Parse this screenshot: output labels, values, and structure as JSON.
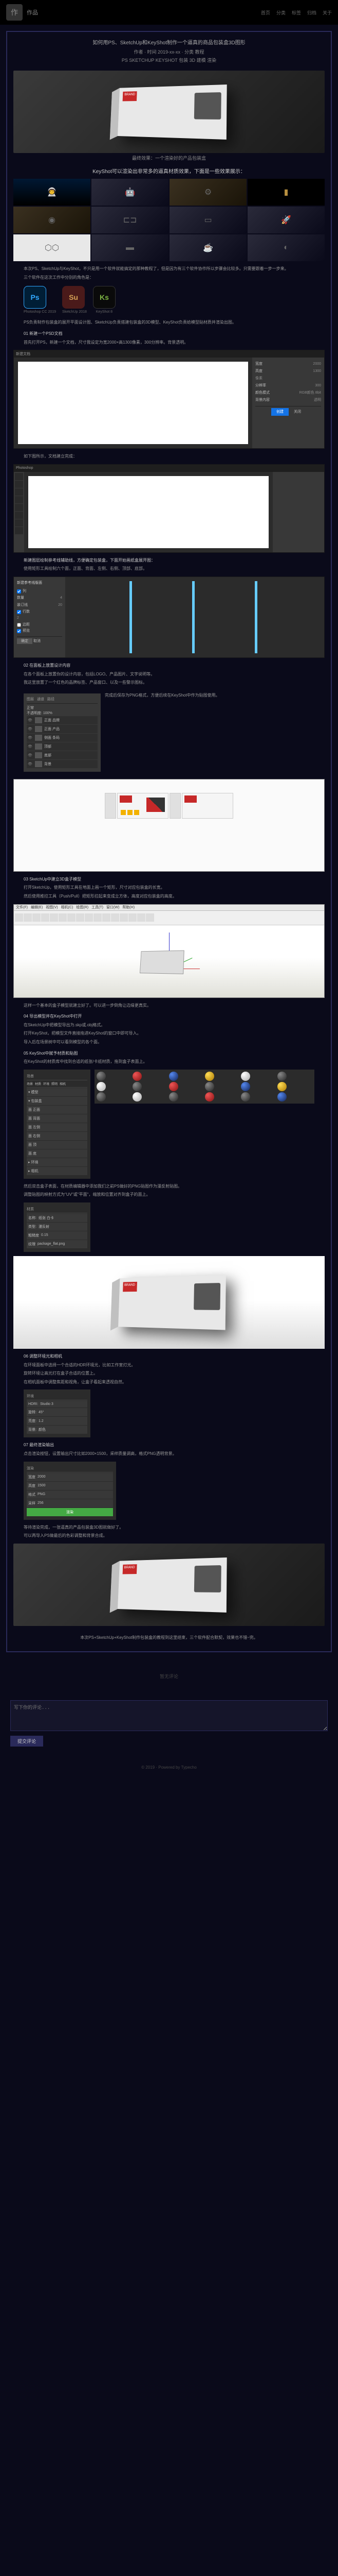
{
  "header": {
    "brand": "作品",
    "nav": [
      "首页",
      "分类",
      "标签",
      "归档",
      "关于"
    ]
  },
  "title": {
    "t1": "如何用PS、SketchUp和KeyShot制作一个逼真的商品包装盒3D图形",
    "t2": "作者 · 时间 2019-xx-xx · 分类 教程",
    "t3": "PS SKETCHUP KEYSHOT 包装 3D 建模 渲染"
  },
  "hero_cap": "最终效果：一个渲染好的产品包装盒",
  "grid_cap": "KeyShot可以渲染出非常多的逼真材质效果，下面是一些效果展示：",
  "body": {
    "p1": "本次PS、SketchUp与KeyShot，不只是用一个软件就能搞定的那种教程了，但是因为有三个软件协作所以步骤会比较多。只需要跟着一步一步来。",
    "p2": "三个软件在这次工作中分别的角色是：",
    "apps": [
      {
        "id": "Ps",
        "lbl": "Photoshop CC 2019"
      },
      {
        "id": "Su",
        "lbl": "SketchUp 2018"
      },
      {
        "id": "Ks",
        "lbl": "KeyShot 8"
      }
    ],
    "p3": "PS负责制作包装盒的展开平面设计图、SketchUp负责搭建包装盒的3D模型、KeyShot负责给模型贴材质并渲染出图。"
  },
  "step1": {
    "h": "01 新建一个PSD文档",
    "p1": "首先打开PS，新建一个文档，尺寸我设定为宽2000×高1300像素，300分辨率。背景透明。",
    "p2": "如下图所示，文档建立完成：",
    "dlg": {
      "title": "新建文档",
      "w": "宽度",
      "wv": "2000",
      "h": "高度",
      "hv": "1300",
      "unit": "像素",
      "res": "分辨率",
      "resv": "300",
      "mode": "颜色模式",
      "modev": "RGB颜色 8bit",
      "bg": "背景内容",
      "bgv": "透明",
      "ok": "创建",
      "cancel": "关闭"
    }
  },
  "step2": {
    "h": "新建图层绘制参考线辅助线，方便确定包装盒，下面开始画纸盒展开图：",
    "p1": "使用矩形工具绘制六个面，正面、背面、左侧、右侧、顶部、底部。",
    "guide": {
      "title": "新建参考线版面",
      "col": "列",
      "colv": "4",
      "gut": "装订线",
      "gutv": "20",
      "row": "行数",
      "rowv": "2",
      "mar": "边距",
      "ok": "确定",
      "cancel": "取消",
      "preview": "预览"
    }
  },
  "step3": {
    "h": "02 在面板上放置设计内容",
    "p1": "在各个面板上放置你的设计内容，包括LOGO、产品图片、文字说明等。",
    "p2": "我这里放置了一个红色的品牌标签、产品窗口、以及一些警示图标。",
    "p3": "完成后保存为PNG格式，方便后续在KeyShot中作为贴图使用。",
    "layers": {
      "tabs": [
        "图层",
        "通道",
        "路径"
      ],
      "mode": "正常",
      "opacity": "不透明度: 100%",
      "items": [
        "正面 品牌",
        "正面 产品",
        "侧面 条码",
        "顶部",
        "底部",
        "背景"
      ]
    }
  },
  "step4": {
    "h": "03 SketchUp中建立3D盒子模型",
    "p1": "打开SketchUp，使用矩形工具在地面上画一个矩形，尺寸对应包装盒的长宽。",
    "p2": "然后使用推拉工具（Push/Pull）把矩形拉起来变成立方体，高度对应包装盒的高度。",
    "p3": "这样一个基本的盒子模型就建立好了。可以进一步倒角让边缘更真实。",
    "menu": [
      "文件(F)",
      "编辑(E)",
      "视图(V)",
      "相机(C)",
      "绘图(R)",
      "工具(T)",
      "窗口(W)",
      "帮助(H)"
    ]
  },
  "step5": {
    "h": "04 导出模型并在KeyShot中打开",
    "p1": "在SketchUp中把模型导出为.skp或.obj格式。",
    "p2": "打开KeyShot，把模型文件直接拖进KeyShot的窗口中即可导入。",
    "p3": "导入后在场景树中可以看到模型的各个面。"
  },
  "step6": {
    "h": "05 KeyShot中赋予材质和贴图",
    "p1": "在KeyShot的材质库中找到合适的纸张/卡纸材质，拖到盒子表面上。",
    "p2": "然后双击盒子表面，在材质编辑器中添加我们之前PS做好的PNG贴图作为漫反射贴图。",
    "p3": "调整贴图的映射方式为\"UV\"或\"平面\"，缩放和位置对齐到盒子的面上。",
    "scene": {
      "title": "场景",
      "tabs": [
        "场景",
        "材质",
        "环境",
        "照明",
        "相机",
        "图像"
      ],
      "items": [
        "▾ 模型",
        "  ▾ 包装盒",
        "    面 正面",
        "    面 背面",
        "    面 左侧",
        "    面 右侧",
        "    面 顶",
        "    面 底",
        "▸ 环境",
        "▸ 相机"
      ]
    },
    "mat": {
      "title": "材质",
      "name": "名称:",
      "namev": "纸张 白卡",
      "type": "类型:",
      "typev": "漫反射",
      "rough": "粗糙度",
      "roughv": "0.15",
      "tex": "纹理",
      "texv": "package_flat.png"
    }
  },
  "step7": {
    "h": "06 调整环境光和相机",
    "p1": "在环境面板中选择一个合适的HDR环境光，比如工作室灯光。",
    "p2": "旋转环境让高光打在盒子合适的位置上。",
    "p3": "在相机面板中调整焦距和视角，让盒子看起来透视自然。",
    "env": {
      "title": "环境",
      "hdri": "HDRI:",
      "hdriv": "Studio 3",
      "rot": "旋转:",
      "rotv": "45°",
      "bright": "亮度:",
      "brightv": "1.2",
      "bg": "背景:",
      "bgv": "颜色"
    }
  },
  "step8": {
    "h": "07 最终渲染输出",
    "p1": "点击渲染按钮，设置输出尺寸比如2000×1500，采样质量调高，格式PNG透明背景。",
    "p2": "等待渲染完成，一张逼真的产品包装盒3D图就做好了。",
    "p3": "可以再导入PS做最后的色彩调整和背景合成。",
    "render": {
      "title": "渲染",
      "w": "宽度",
      "wv": "2000",
      "h": "高度",
      "hv": "1500",
      "fmt": "格式",
      "fmtv": "PNG",
      "samp": "采样",
      "sampv": "256",
      "btn": "渲染"
    }
  },
  "end": "本次PS+SketchUp+KeyShot制作包装盒的教程到这里结束，三个软件配合默契，效果也不错~完。",
  "comments": {
    "none": "暂无评论",
    "form_ph": "写下你的评论...",
    "submit": "提交评论"
  },
  "footer": "© 2019 · Powered by Typecho"
}
